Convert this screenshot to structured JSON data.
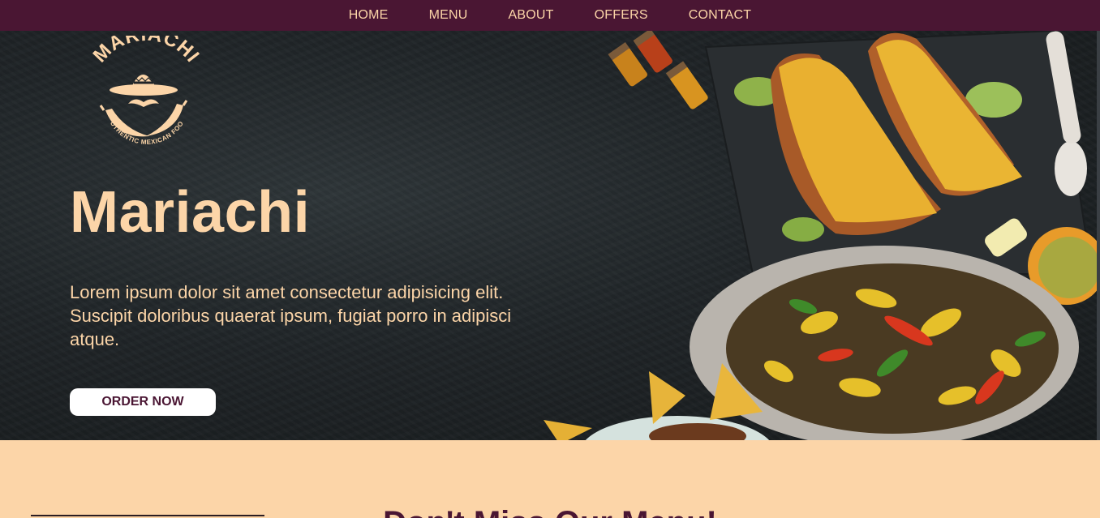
{
  "nav": {
    "items": [
      {
        "label": "HOME"
      },
      {
        "label": "MENU"
      },
      {
        "label": "ABOUT"
      },
      {
        "label": "OFFERS"
      },
      {
        "label": "CONTACT"
      }
    ]
  },
  "logo": {
    "brand": "MARIACHI",
    "tagline": "AUTHENTIC MEXICAN FOOD"
  },
  "hero": {
    "title": "Mariachi",
    "text": "Lorem ipsum dolor sit amet consectetur adipisicing elit. Suscipit doloribus quaerat ipsum, fugiat porro in adipisci atque.",
    "button": "ORDER NOW"
  },
  "section": {
    "heading": "Don't Miss Our Menu!"
  },
  "colors": {
    "nav_bg": "#4a1633",
    "accent": "#fcd5a8",
    "hero_bg": "#1f2427"
  }
}
